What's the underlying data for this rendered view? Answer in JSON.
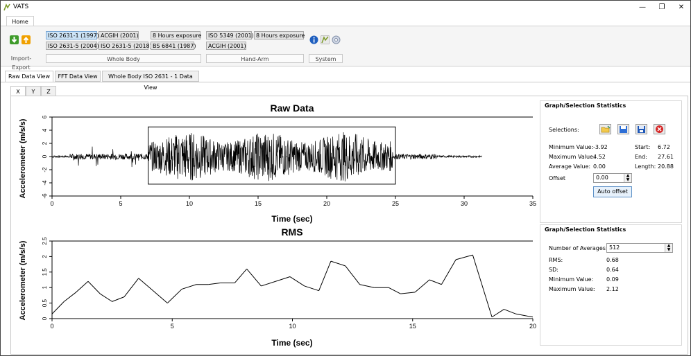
{
  "app": {
    "title": "VATS",
    "ribbon_tab": "Home"
  },
  "ribbon": {
    "whole_body_buttons": [
      "ISO 2631-1 (1997)",
      "ACGIH (2001)",
      "8 Hours exposure",
      "ISO 2631-5 (2004)",
      "ISO 2631-5 (2018)",
      "BS 6841 (1987)"
    ],
    "hand_arm_buttons": [
      "ISO 5349 (2001)",
      "8 Hours exposure",
      "ACGIH (2001)"
    ],
    "groups": {
      "import_export": "Import-Export",
      "whole_body": "Whole Body",
      "hand_arm": "Hand-Arm",
      "system": "System"
    }
  },
  "view_tabs": [
    "Raw Data View",
    "FFT Data View",
    "Whole Body ISO 2631 - 1 Data View"
  ],
  "axis_tabs": [
    "X",
    "Y",
    "Z"
  ],
  "raw_stats": {
    "title": "Graph/Selection Statistics",
    "selections_label": "Selections:",
    "min_label": "Minimum Value:",
    "min_value": "-3.92",
    "max_label": "Maximum Value:",
    "max_value": "4.52",
    "avg_label": "Average Value:",
    "avg_value": "0.00",
    "start_label": "Start:",
    "start_value": "6.72",
    "end_label": "End:",
    "end_value": "27.61",
    "length_label": "Length:",
    "length_value": "20.88",
    "offset_label": "Offset",
    "offset_value": "0.00",
    "auto_offset": "Auto offset"
  },
  "rms_stats": {
    "title": "Graph/Selection Statistics",
    "avg_count_label": "Number of Averages:",
    "avg_count_value": "512",
    "rms_label": "RMS:",
    "rms_value": "0.68",
    "sd_label": "SD:",
    "sd_value": "0.64",
    "min_label": "Minimum Value:",
    "min_value": "0.09",
    "max_label": "Maximum Value:",
    "max_value": "2.12"
  },
  "chart_data": [
    {
      "type": "line",
      "title": "Raw Data",
      "xlabel": "Time (sec)",
      "ylabel": "Accelerometer (m/s/s)",
      "xlim": [
        0,
        35
      ],
      "ylim": [
        -6,
        6
      ],
      "xticks": [
        0,
        5,
        10,
        15,
        20,
        25,
        30,
        35
      ],
      "yticks": [
        -6,
        -4,
        -2,
        0,
        2,
        4,
        6
      ],
      "data_end_sec": 31.3,
      "selection": [
        7,
        25
      ],
      "grid": false
    },
    {
      "type": "line",
      "title": "RMS",
      "xlabel": "Time (sec)",
      "ylabel": "Accelerometer (m/s/s)",
      "xlim": [
        0,
        20
      ],
      "ylim": [
        0,
        2.5
      ],
      "xticks": [
        0,
        5,
        10,
        15,
        20
      ],
      "yticks": [
        0,
        0.5,
        1,
        1.5,
        2,
        2.5
      ],
      "x": [
        0,
        0.5,
        1,
        1.5,
        2,
        2.5,
        3,
        3.6,
        4.2,
        4.8,
        5.4,
        6,
        6.5,
        7,
        7.6,
        8.1,
        8.7,
        9.3,
        9.9,
        10.5,
        11.1,
        11.6,
        12.2,
        12.8,
        13.4,
        14,
        14.5,
        15.1,
        15.7,
        16.2,
        16.8,
        17.5,
        17.8,
        18.3,
        18.8,
        19.3,
        20
      ],
      "y": [
        0.15,
        0.55,
        0.85,
        1.2,
        0.8,
        0.55,
        0.7,
        1.3,
        0.9,
        0.5,
        0.95,
        1.1,
        1.1,
        1.15,
        1.15,
        1.6,
        1.05,
        1.2,
        1.35,
        1.05,
        0.9,
        1.85,
        1.7,
        1.1,
        1.0,
        1.0,
        0.8,
        0.85,
        1.25,
        1.1,
        1.9,
        2.05,
        1.3,
        0.05,
        0.3,
        0.15,
        0.05
      ]
    }
  ]
}
